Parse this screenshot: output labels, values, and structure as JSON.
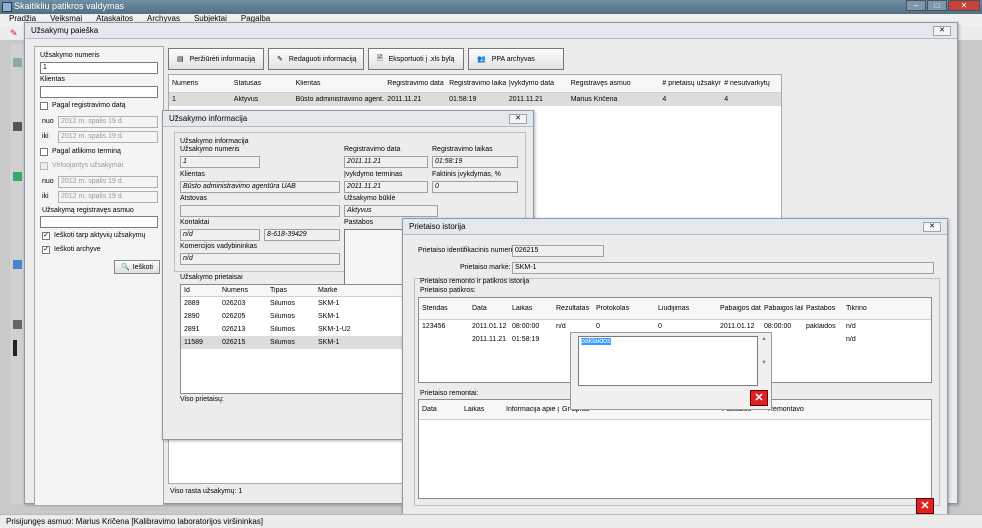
{
  "app": {
    "title": "Skaitikliu patikros valdymas",
    "menu": [
      "Pradžia",
      "Veiksmai",
      "Ataskaitos",
      "Archyvas",
      "Subjektai",
      "Pagalba"
    ],
    "status": "Prisijungęs asmuo: Marius Kričena [Kalibravimo laboratorijos viršininkas]"
  },
  "search": {
    "title": "Užsakymų paieška",
    "order_no_label": "Užsakymo numeris",
    "order_no": "1",
    "client_label": "Klientas",
    "client": "",
    "by_reg_date": "Pagal registravimo datą",
    "from_label": "nuo",
    "to_label": "iki",
    "date1": "2012 m.   spalis   19 d.",
    "date2": "2012 m.   spalis   19 d.",
    "date3": "2012 m.   spalis   19 d.",
    "date4": "2012 m.   spalis   19 d.",
    "by_deadline": "Pagal atlikimo terminą",
    "late": "Vėluojantys užsakymai",
    "registrar_label": "Užsakymą registravęs asmuo",
    "registrar": "",
    "active": "Ieškoti tarp aktyvių užsakymų",
    "archive": "Ieškoti archyve",
    "search_btn": "Ieškoti",
    "found": "Viso rasta užsakymų: 1"
  },
  "toolbar": {
    "view": "Peržiūrėti informaciją",
    "edit": "Redaguoti informaciją",
    "export": "Eksportuoti į .xls bylą",
    "ppa": "PPA archyvas"
  },
  "orders": {
    "headers": [
      "Numeris",
      "Statusas",
      "Klientas",
      "Registravimo data",
      "Registravimo laikas",
      "Įvykdymo data",
      "Registravęs asmuo",
      "# prietaisų užsakyme",
      "# nesutvarkytų"
    ],
    "rows": [
      [
        "1",
        "Aktyvus",
        "Būsto administravimo agent...",
        "2011.11.21",
        "01:58:19",
        "2011.11.21",
        "Marius Kričena",
        "4",
        "4"
      ]
    ]
  },
  "order_info": {
    "title": "Užsakymo informacija",
    "group": "Užsakymo informacija",
    "no_label": "Užsakymo numeris",
    "no": "1",
    "reg_date_label": "Registravimo data",
    "reg_date": "2011.11.21",
    "reg_time_label": "Registravimo laikas",
    "reg_time": "01:58:19",
    "client_label": "Klientas",
    "client": "Būsto administravimo agentūra UAB",
    "deadline_label": "Įvykdymo terminas",
    "deadline": "2011.11.21",
    "actual_label": "Faktinis įvykdymas, %",
    "actual": "0",
    "rep_label": "Atstovas",
    "rep": "",
    "state_label": "Užsakymo būklė",
    "state": "Aktyvus",
    "contacts_label": "Kontaktai",
    "contact1": "n/d",
    "contact2": "8-618-39429",
    "notes_label": "Pastabos",
    "manager_label": "Komercijos vadybininkas",
    "manager": "n/d",
    "devices_label": "Užsakymo prietaisai",
    "dev_headers": [
      "Id",
      "Numeris",
      "Tipas",
      "Markė"
    ],
    "devices": [
      [
        "2889",
        "026203",
        "Šilumos",
        "SKM-1"
      ],
      [
        "2890",
        "026205",
        "Šilumos",
        "SKM-1"
      ],
      [
        "2891",
        "026213",
        "Šilumos",
        "SKM-1-U2"
      ],
      [
        "11589",
        "026215",
        "Šilumos",
        "SKM-1"
      ]
    ],
    "total_label": "Viso prietaisų:"
  },
  "history": {
    "title": "Prietaiso istorija",
    "id_label": "Prietaiso identifikacinis numeris:",
    "id": "026215",
    "brand_label": "Prietaiso markė:",
    "brand": "SKM-1",
    "group": "Prietaiso remonto ir patikros istorija",
    "checks_label": "Prietaiso patikros:",
    "check_headers": [
      "Stendas",
      "Data",
      "Laikas",
      "Rezultatas",
      "Protokolas",
      "Liudijimas",
      "Pabaigos data",
      "Pabaigos laikas",
      "Pastabos",
      "Tikrino"
    ],
    "checks": [
      [
        "123456",
        "2011.01.12",
        "08:00:00",
        "n/d",
        "0",
        "0",
        "2011.01.12",
        "08:00:00",
        "paklaidos",
        "n/d"
      ],
      [
        "",
        "2011.11.21",
        "01:58:19",
        "",
        "",
        "",
        "",
        "",
        "",
        "n/d"
      ]
    ],
    "repairs_label": "Prietaiso remontai:",
    "repair_headers": [
      "Data",
      "Laikas",
      "Informacija apie gedimą",
      "Gr apras",
      "",
      "",
      "",
      "Pastabos",
      "Remontavo"
    ],
    "popup_text": "paklaidos"
  }
}
